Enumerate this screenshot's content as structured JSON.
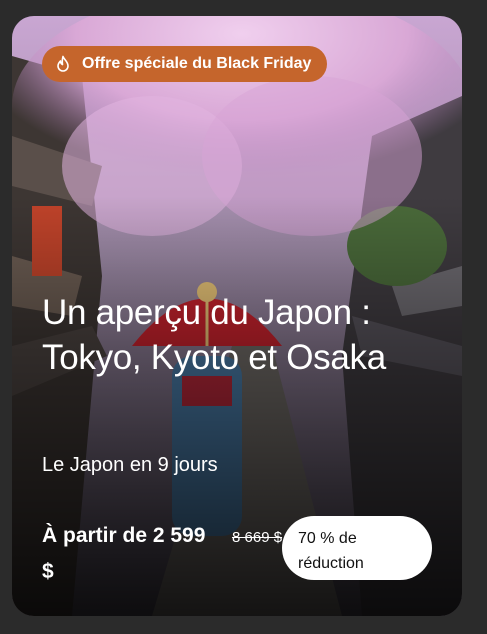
{
  "badge": {
    "label": "Offre spéciale du Black Friday",
    "icon": "flame-icon",
    "color": "#c5652c"
  },
  "tour": {
    "title": "Un aperçu du Japon : Tokyo, Kyoto et Osaka",
    "subtitle": "Le Japon en 9 jours"
  },
  "pricing": {
    "from_label": "À partir de 2 599 $",
    "original_price": "8 669 $",
    "discount_label": "70 % de réduction"
  },
  "colors": {
    "card_background": "#3a3340",
    "accent": "#c5652c",
    "blossom": "#d9a8d6"
  }
}
